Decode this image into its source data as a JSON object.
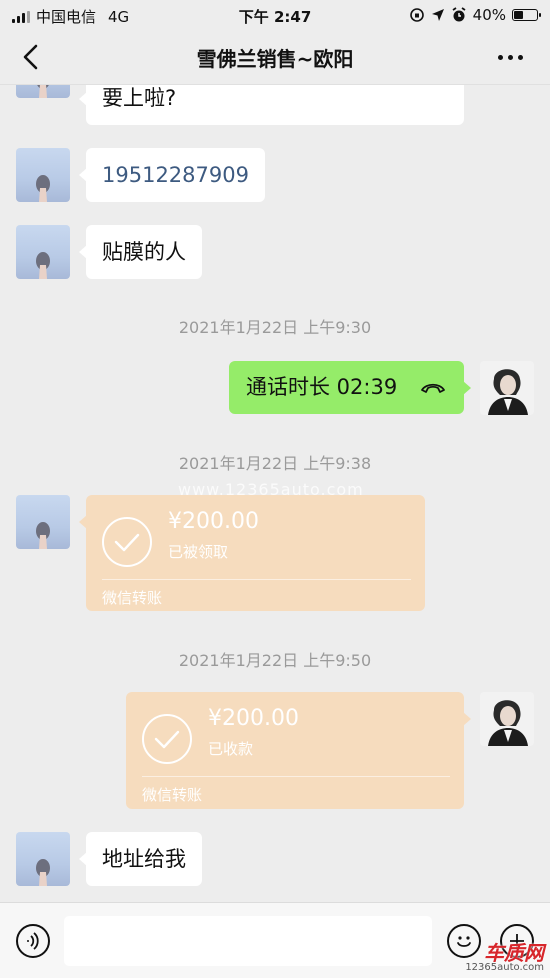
{
  "status_bar": {
    "carrier": "中国电信",
    "network": "4G",
    "time": "下午 2:47",
    "battery": "40%"
  },
  "header": {
    "title": "雪佛兰销售~欧阳"
  },
  "messages": [
    {
      "type": "text",
      "side": "left",
      "text": "要上啦?"
    },
    {
      "type": "text",
      "side": "left",
      "text": "19512287909"
    },
    {
      "type": "text",
      "side": "left",
      "text": "贴膜的人"
    },
    {
      "type": "timestamp",
      "text": "2021年1月22日 上午9:30"
    },
    {
      "type": "call",
      "side": "right",
      "text": "通话时长 02:39"
    },
    {
      "type": "timestamp",
      "text": "2021年1月22日 上午9:38"
    },
    {
      "type": "transfer",
      "side": "left",
      "amount": "¥200.00",
      "status": "已被领取",
      "footer": "微信转账"
    },
    {
      "type": "timestamp",
      "text": "2021年1月22日 上午9:50"
    },
    {
      "type": "transfer",
      "side": "right",
      "amount": "¥200.00",
      "status": "已收款",
      "footer": "微信转账"
    },
    {
      "type": "text",
      "side": "left",
      "text": "地址给我"
    }
  ],
  "watermark": "www.12365auto.com",
  "logo_watermark": {
    "name": "车质网",
    "url": "12365auto.com"
  },
  "input_bar": {
    "placeholder": ""
  },
  "colors": {
    "background": "#ededed",
    "sent_bubble": "#95ec69",
    "transfer_bubble": "#f6dcbe",
    "timestamp_text": "#9a9a9a"
  }
}
